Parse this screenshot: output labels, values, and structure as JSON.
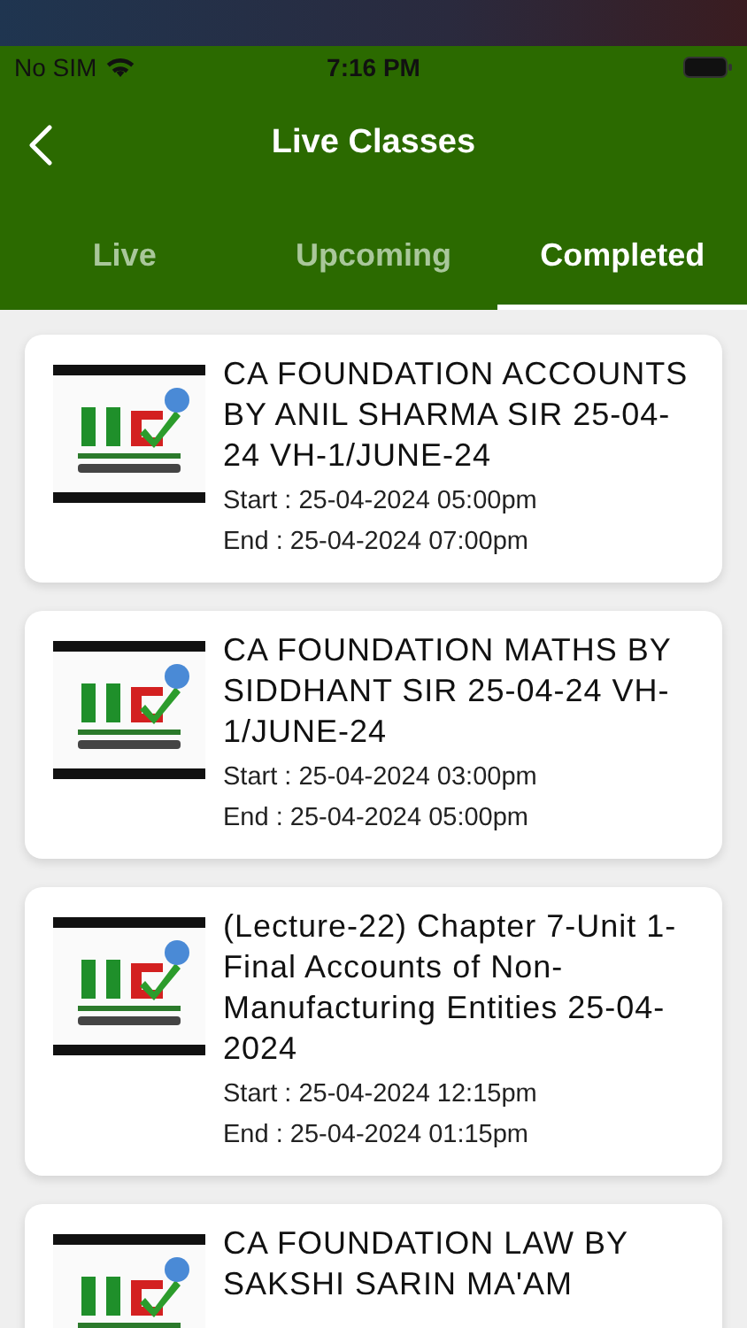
{
  "status_bar": {
    "carrier": "No SIM",
    "time": "7:16 PM"
  },
  "header": {
    "title": "Live Classes"
  },
  "tabs": [
    {
      "label": "Live",
      "selected": false
    },
    {
      "label": "Upcoming",
      "selected": false
    },
    {
      "label": "Completed",
      "selected": true
    }
  ],
  "classes": [
    {
      "title": "CA FOUNDATION ACCOUNTS BY ANIL SHARMA SIR 25-04-24 VH-1/JUNE-24",
      "start": "Start : 25-04-2024 05:00pm",
      "end": "End : 25-04-2024 07:00pm"
    },
    {
      "title": "CA FOUNDATION MATHS BY SIDDHANT SIR 25-04-24 VH-1/JUNE-24",
      "start": "Start : 25-04-2024 03:00pm",
      "end": "End : 25-04-2024 05:00pm"
    },
    {
      "title": "(Lecture-22) Chapter 7-Unit 1- Final Accounts of Non-Manufacturing Entities 25-04-2024",
      "start": "Start : 25-04-2024 12:15pm",
      "end": "End : 25-04-2024 01:15pm"
    },
    {
      "title": "CA FOUNDATION LAW BY SAKSHI SARIN MA'AM"
    }
  ]
}
